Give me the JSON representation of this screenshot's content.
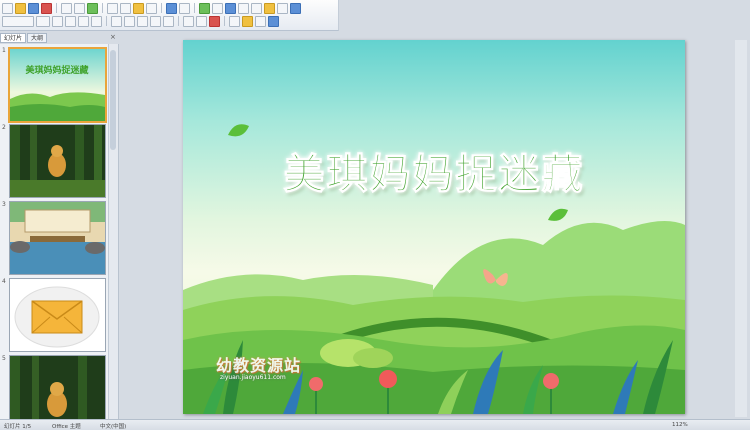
{
  "app": {
    "toolbar_buttons": 46
  },
  "pane": {
    "tabs": [
      "幻灯片",
      "大纲"
    ],
    "close_label": "×"
  },
  "slides": [
    {
      "number": "1",
      "selected": true,
      "title": "美琪妈妈捉迷藏"
    },
    {
      "number": "2"
    },
    {
      "number": "3"
    },
    {
      "number": "4"
    },
    {
      "number": "5"
    }
  ],
  "slide": {
    "title": "美琪妈妈捉迷藏",
    "watermark_text": "幼教资源站",
    "watermark_url": "ziyuan.jiaoyu611.com"
  },
  "status": {
    "slide_info": "幻灯片 1/5",
    "theme": "Office 主题",
    "language": "中文(中国)",
    "zoom": "112%"
  },
  "colors": {
    "title_green": "#3fa22b",
    "sky_top": "#63d2cf",
    "grass": "#8fd25a",
    "selection": "#e9a53b"
  }
}
